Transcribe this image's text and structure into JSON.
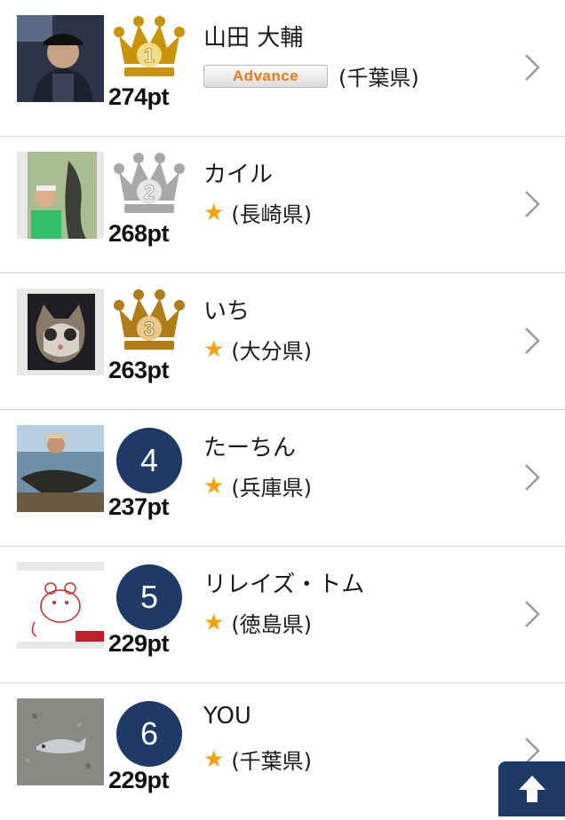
{
  "ranking": [
    {
      "rank": "1",
      "name": "山田 大輔",
      "points": "274pt",
      "badge": "Advance",
      "prefecture": "(千葉県)",
      "rank_style": "gold-crown"
    },
    {
      "rank": "2",
      "name": "カイル",
      "points": "268pt",
      "badge": "",
      "prefecture": "(長崎県)",
      "rank_style": "silver-crown"
    },
    {
      "rank": "3",
      "name": "いち",
      "points": "263pt",
      "badge": "",
      "prefecture": "(大分県)",
      "rank_style": "bronze-crown"
    },
    {
      "rank": "4",
      "name": "たーちん",
      "points": "237pt",
      "badge": "",
      "prefecture": "(兵庫県)",
      "rank_style": "circle"
    },
    {
      "rank": "5",
      "name": "リレイズ・トム",
      "points": "229pt",
      "badge": "",
      "prefecture": "(徳島県)",
      "rank_style": "circle"
    },
    {
      "rank": "6",
      "name": "YOU",
      "points": "229pt",
      "badge": "",
      "prefecture": "(千葉県)",
      "rank_style": "circle"
    }
  ],
  "star_glyph": "★",
  "icons": {
    "row_chevron": "chevron-right-icon",
    "scroll_top": "arrow-up-icon"
  },
  "colors": {
    "rank_circle": "#1f3a66",
    "star": "#f5a20a",
    "badge_text": "#f07a1a",
    "gold": "#c9930a",
    "silver": "#a8a8a8",
    "bronze": "#b07d1a"
  }
}
